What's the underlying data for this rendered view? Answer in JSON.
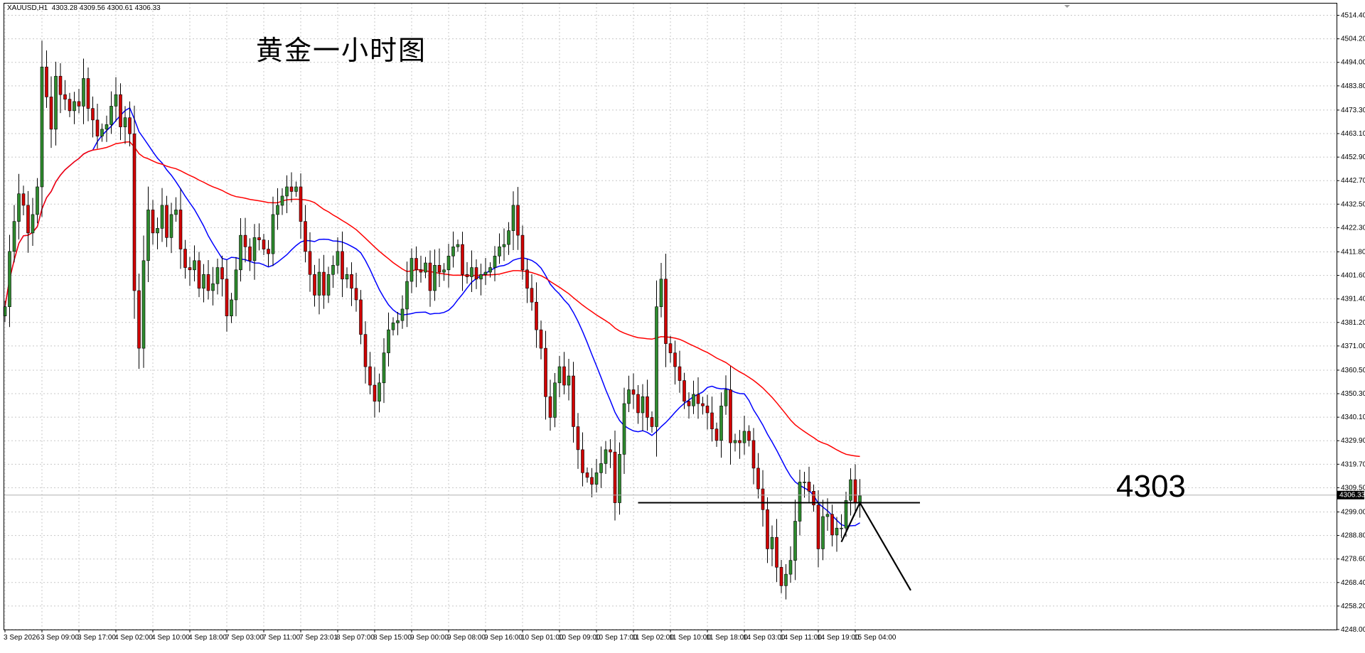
{
  "header": {
    "symbol_info": "XAUUSD,H1  4303.28 4309.56 4300.61 4306.33",
    "title": "黄金一小时图",
    "annotation": "4303"
  },
  "colors": {
    "bull_candle": "#2e8b2e",
    "bear_candle": "#d00000",
    "wick": "#000000",
    "ma_fast": "#0000ff",
    "ma_slow": "#ff0000",
    "grid": "#c8c8c8",
    "level_line": "#000000",
    "price_tag_bg": "#000000",
    "price_tag_text": "#ffffff"
  },
  "chart_data": {
    "type": "candlestick",
    "symbol": "XAUUSD",
    "timeframe": "H1",
    "ylim": [
      4248.0,
      4519.5
    ],
    "y_ticks": [
      4514.4,
      4504.2,
      4494.0,
      4483.8,
      4473.3,
      4463.1,
      4452.9,
      4442.7,
      4432.5,
      4422.3,
      4411.8,
      4401.6,
      4391.4,
      4381.2,
      4371.0,
      4360.5,
      4350.3,
      4340.1,
      4329.9,
      4319.7,
      4309.5,
      4299.0,
      4288.8,
      4278.6,
      4268.4,
      4258.2,
      4248.0
    ],
    "x_ticks": [
      {
        "label": "3 Sep 2026",
        "index": 0
      },
      {
        "label": "3 Sep 09:00",
        "index": 8
      },
      {
        "label": "3 Sep 17:00",
        "index": 16
      },
      {
        "label": "4 Sep 02:00",
        "index": 24
      },
      {
        "label": "4 Sep 10:00",
        "index": 32
      },
      {
        "label": "4 Sep 18:00",
        "index": 40
      },
      {
        "label": "7 Sep 03:00",
        "index": 48
      },
      {
        "label": "7 Sep 11:00",
        "index": 56
      },
      {
        "label": "7 Sep 23:01",
        "index": 64
      },
      {
        "label": "8 Sep 07:00",
        "index": 72
      },
      {
        "label": "8 Sep 15:00",
        "index": 80
      },
      {
        "label": "9 Sep 00:00",
        "index": 88
      },
      {
        "label": "9 Sep 08:00",
        "index": 96
      },
      {
        "label": "9 Sep 16:00",
        "index": 104
      },
      {
        "label": "10 Sep 01:00",
        "index": 112
      },
      {
        "label": "10 Sep 09:00",
        "index": 120
      },
      {
        "label": "10 Sep 17:00",
        "index": 128
      },
      {
        "label": "11 Sep 02:00",
        "index": 136
      },
      {
        "label": "11 Sep 10:00",
        "index": 144
      },
      {
        "label": "11 Sep 18:00",
        "index": 152
      },
      {
        "label": "14 Sep 03:00",
        "index": 160
      },
      {
        "label": "14 Sep 11:00",
        "index": 168
      },
      {
        "label": "14 Sep 19:00",
        "index": 176
      },
      {
        "label": "15 Sep 04:00",
        "index": 184
      }
    ],
    "current_price": 4306.33,
    "current_price_label": "4306.33",
    "support_level": 4303.0,
    "support_from_index": 137,
    "support_to_index": 198,
    "projection": [
      {
        "index": 181,
        "price": 4286
      },
      {
        "index": 185,
        "price": 4303
      },
      {
        "index": 196,
        "price": 4265
      }
    ],
    "close": [
      4388,
      4412,
      4425,
      4437,
      4432,
      4420,
      4428,
      4440,
      4492,
      4479,
      4465,
      4488,
      4480,
      4478,
      4473,
      4477,
      4475,
      4487,
      4474,
      4469,
      4462,
      4465,
      4467,
      4475,
      4480,
      4466,
      4470,
      4463,
      4395,
      4370,
      4408,
      4430,
      4420,
      4422,
      4432,
      4418,
      4428,
      4430,
      4413,
      4405,
      4404,
      4408,
      4396,
      4402,
      4395,
      4398,
      4405,
      4400,
      4384,
      4391,
      4404,
      4419,
      4414,
      4408,
      4418,
      4417,
      4413,
      4411,
      4428,
      4432,
      4436,
      4440,
      4438,
      4440,
      4425,
      4412,
      4402,
      4393,
      4403,
      4393,
      4402,
      4406,
      4412,
      4400,
      4402,
      4396,
      4391,
      4376,
      4362,
      4354,
      4347,
      4355,
      4368,
      4378,
      4381,
      4382,
      4387,
      4399,
      4409,
      4404,
      4403,
      4407,
      4395,
      4406,
      4403,
      4404,
      4410,
      4414,
      4415,
      4402,
      4401,
      4405,
      4400,
      4402,
      4403,
      4405,
      4410,
      4414,
      4415,
      4421,
      4432,
      4419,
      4404,
      4396,
      4390,
      4378,
      4370,
      4349,
      4340,
      4355,
      4362,
      4354,
      4358,
      4336,
      4326,
      4316,
      4314,
      4311,
      4316,
      4320,
      4326,
      4325,
      4303,
      4324,
      4346,
      4352,
      4350,
      4342,
      4349,
      4340,
      4336,
      4388,
      4400,
      4372,
      4368,
      4362,
      4356,
      4347,
      4345,
      4350,
      4346,
      4345,
      4342,
      4335,
      4330,
      4345,
      4352,
      4329,
      4330,
      4329,
      4334,
      4330,
      4318,
      4309,
      4300,
      4283,
      4288,
      4275,
      4267,
      4272,
      4278,
      4295,
      4312,
      4312,
      4308,
      4302,
      4283,
      4297,
      4298,
      4289,
      4292,
      4292,
      4304,
      4313,
      4303,
      4306
    ]
  }
}
